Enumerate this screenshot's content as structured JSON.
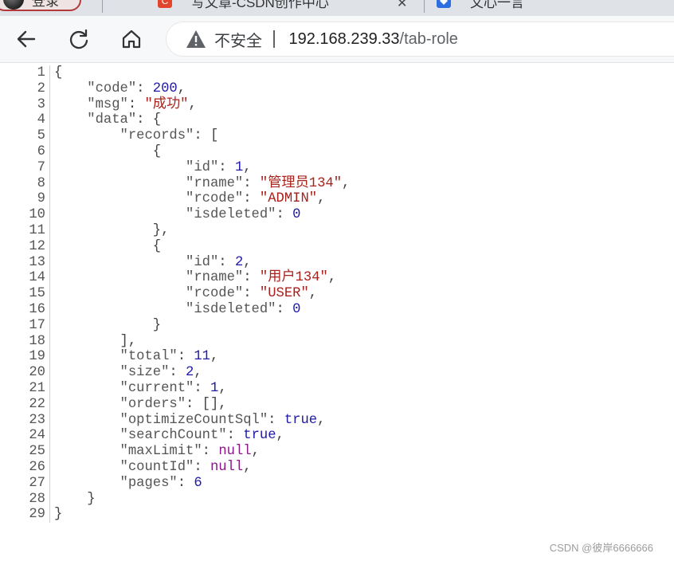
{
  "tabs": [
    {
      "title": "登录"
    },
    {
      "title": "写文章-CSDN创作中心"
    },
    {
      "title": "文心一言"
    }
  ],
  "tab_close_glyph": "✕",
  "favicon_csdn_letter": "C",
  "toolbar": {
    "back_icon": "arrow-back-icon",
    "reload_icon": "reload-icon",
    "home_icon": "home-icon"
  },
  "address_bar": {
    "security_label": "不安全",
    "url_host": "192.168.239.33",
    "url_path": "/tab-role"
  },
  "json_viewer": {
    "lines": [
      [
        {
          "t": "p",
          "v": "{"
        }
      ],
      [
        {
          "t": "p",
          "v": "    "
        },
        {
          "t": "k",
          "v": "\"code\""
        },
        {
          "t": "p",
          "v": ": "
        },
        {
          "t": "n",
          "v": "200"
        },
        {
          "t": "p",
          "v": ","
        }
      ],
      [
        {
          "t": "p",
          "v": "    "
        },
        {
          "t": "k",
          "v": "\"msg\""
        },
        {
          "t": "p",
          "v": ": "
        },
        {
          "t": "s",
          "v": "\"成功\""
        },
        {
          "t": "p",
          "v": ","
        }
      ],
      [
        {
          "t": "p",
          "v": "    "
        },
        {
          "t": "k",
          "v": "\"data\""
        },
        {
          "t": "p",
          "v": ": {"
        }
      ],
      [
        {
          "t": "p",
          "v": "        "
        },
        {
          "t": "k",
          "v": "\"records\""
        },
        {
          "t": "p",
          "v": ": ["
        }
      ],
      [
        {
          "t": "p",
          "v": "            {"
        }
      ],
      [
        {
          "t": "p",
          "v": "                "
        },
        {
          "t": "k",
          "v": "\"id\""
        },
        {
          "t": "p",
          "v": ": "
        },
        {
          "t": "n",
          "v": "1"
        },
        {
          "t": "p",
          "v": ","
        }
      ],
      [
        {
          "t": "p",
          "v": "                "
        },
        {
          "t": "k",
          "v": "\"rname\""
        },
        {
          "t": "p",
          "v": ": "
        },
        {
          "t": "s",
          "v": "\"管理员134\""
        },
        {
          "t": "p",
          "v": ","
        }
      ],
      [
        {
          "t": "p",
          "v": "                "
        },
        {
          "t": "k",
          "v": "\"rcode\""
        },
        {
          "t": "p",
          "v": ": "
        },
        {
          "t": "s",
          "v": "\"ADMIN\""
        },
        {
          "t": "p",
          "v": ","
        }
      ],
      [
        {
          "t": "p",
          "v": "                "
        },
        {
          "t": "k",
          "v": "\"isdeleted\""
        },
        {
          "t": "p",
          "v": ": "
        },
        {
          "t": "n",
          "v": "0"
        }
      ],
      [
        {
          "t": "p",
          "v": "            },"
        }
      ],
      [
        {
          "t": "p",
          "v": "            {"
        }
      ],
      [
        {
          "t": "p",
          "v": "                "
        },
        {
          "t": "k",
          "v": "\"id\""
        },
        {
          "t": "p",
          "v": ": "
        },
        {
          "t": "n",
          "v": "2"
        },
        {
          "t": "p",
          "v": ","
        }
      ],
      [
        {
          "t": "p",
          "v": "                "
        },
        {
          "t": "k",
          "v": "\"rname\""
        },
        {
          "t": "p",
          "v": ": "
        },
        {
          "t": "s",
          "v": "\"用户134\""
        },
        {
          "t": "p",
          "v": ","
        }
      ],
      [
        {
          "t": "p",
          "v": "                "
        },
        {
          "t": "k",
          "v": "\"rcode\""
        },
        {
          "t": "p",
          "v": ": "
        },
        {
          "t": "s",
          "v": "\"USER\""
        },
        {
          "t": "p",
          "v": ","
        }
      ],
      [
        {
          "t": "p",
          "v": "                "
        },
        {
          "t": "k",
          "v": "\"isdeleted\""
        },
        {
          "t": "p",
          "v": ": "
        },
        {
          "t": "n",
          "v": "0"
        }
      ],
      [
        {
          "t": "p",
          "v": "            }"
        }
      ],
      [
        {
          "t": "p",
          "v": "        ],"
        }
      ],
      [
        {
          "t": "p",
          "v": "        "
        },
        {
          "t": "k",
          "v": "\"total\""
        },
        {
          "t": "p",
          "v": ": "
        },
        {
          "t": "n",
          "v": "11"
        },
        {
          "t": "p",
          "v": ","
        }
      ],
      [
        {
          "t": "p",
          "v": "        "
        },
        {
          "t": "k",
          "v": "\"size\""
        },
        {
          "t": "p",
          "v": ": "
        },
        {
          "t": "n",
          "v": "2"
        },
        {
          "t": "p",
          "v": ","
        }
      ],
      [
        {
          "t": "p",
          "v": "        "
        },
        {
          "t": "k",
          "v": "\"current\""
        },
        {
          "t": "p",
          "v": ": "
        },
        {
          "t": "n",
          "v": "1"
        },
        {
          "t": "p",
          "v": ","
        }
      ],
      [
        {
          "t": "p",
          "v": "        "
        },
        {
          "t": "k",
          "v": "\"orders\""
        },
        {
          "t": "p",
          "v": ": [],"
        }
      ],
      [
        {
          "t": "p",
          "v": "        "
        },
        {
          "t": "k",
          "v": "\"optimizeCountSql\""
        },
        {
          "t": "p",
          "v": ": "
        },
        {
          "t": "b",
          "v": "true"
        },
        {
          "t": "p",
          "v": ","
        }
      ],
      [
        {
          "t": "p",
          "v": "        "
        },
        {
          "t": "k",
          "v": "\"searchCount\""
        },
        {
          "t": "p",
          "v": ": "
        },
        {
          "t": "b",
          "v": "true"
        },
        {
          "t": "p",
          "v": ","
        }
      ],
      [
        {
          "t": "p",
          "v": "        "
        },
        {
          "t": "k",
          "v": "\"maxLimit\""
        },
        {
          "t": "p",
          "v": ": "
        },
        {
          "t": "nl",
          "v": "null"
        },
        {
          "t": "p",
          "v": ","
        }
      ],
      [
        {
          "t": "p",
          "v": "        "
        },
        {
          "t": "k",
          "v": "\"countId\""
        },
        {
          "t": "p",
          "v": ": "
        },
        {
          "t": "nl",
          "v": "null"
        },
        {
          "t": "p",
          "v": ","
        }
      ],
      [
        {
          "t": "p",
          "v": "        "
        },
        {
          "t": "k",
          "v": "\"pages\""
        },
        {
          "t": "p",
          "v": ": "
        },
        {
          "t": "n",
          "v": "6"
        }
      ],
      [
        {
          "t": "p",
          "v": "    }"
        }
      ],
      [
        {
          "t": "p",
          "v": "}"
        }
      ]
    ]
  },
  "watermark": "CSDN @彼岸6666666",
  "colors": {
    "json_key": "#555555",
    "json_number": "#1f1aaa",
    "json_string": "#a8221d",
    "json_null": "#8a1a8a"
  }
}
